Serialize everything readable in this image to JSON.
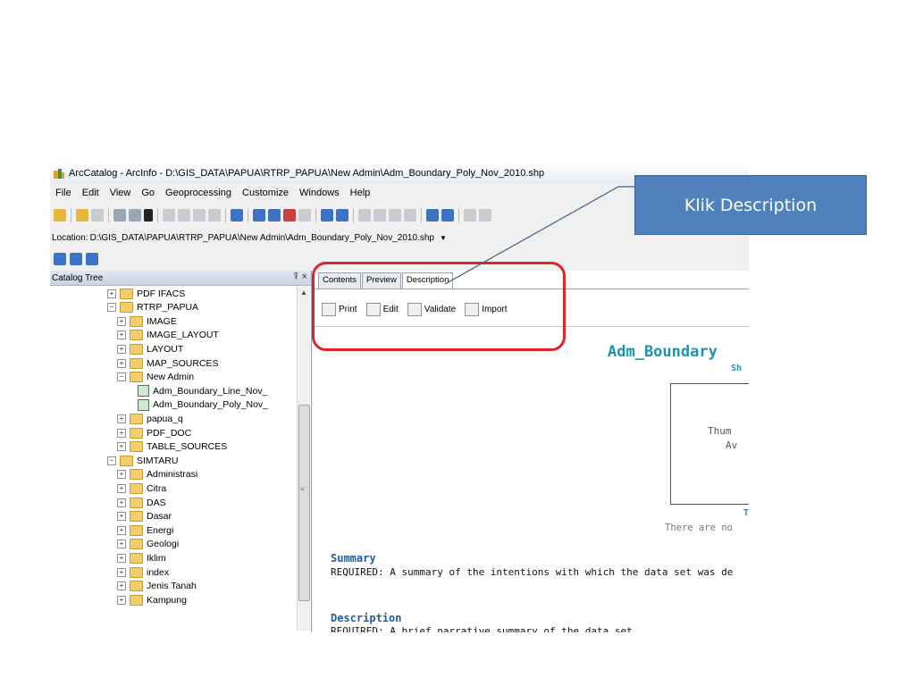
{
  "window": {
    "title": "ArcCatalog - ArcInfo - D:\\GIS_DATA\\PAPUA\\RTRP_PAPUA\\New Admin\\Adm_Boundary_Poly_Nov_2010.shp"
  },
  "menu": [
    "File",
    "Edit",
    "View",
    "Go",
    "Geoprocessing",
    "Customize",
    "Windows",
    "Help"
  ],
  "location": {
    "label": "Location:",
    "value": "D:\\GIS_DATA\\PAPUA\\RTRP_PAPUA\\New Admin\\Adm_Boundary_Poly_Nov_2010.shp"
  },
  "catalog_tree": {
    "title": "Catalog Tree",
    "pins": "⍒ ×",
    "items": [
      {
        "label": "PDF IFACS",
        "level": 0,
        "expander": "+",
        "kind": "folder"
      },
      {
        "label": "RTRP_PAPUA",
        "level": 0,
        "expander": "−",
        "kind": "folder"
      },
      {
        "label": "IMAGE",
        "level": 1,
        "expander": "+",
        "kind": "folder"
      },
      {
        "label": "IMAGE_LAYOUT",
        "level": 1,
        "expander": "+",
        "kind": "folder"
      },
      {
        "label": "LAYOUT",
        "level": 1,
        "expander": "+",
        "kind": "folder"
      },
      {
        "label": "MAP_SOURCES",
        "level": 1,
        "expander": "+",
        "kind": "folder"
      },
      {
        "label": "New Admin",
        "level": 1,
        "expander": "−",
        "kind": "folder"
      },
      {
        "label": "Adm_Boundary_Line_Nov_",
        "level": 2,
        "expander": "",
        "kind": "line"
      },
      {
        "label": "Adm_Boundary_Poly_Nov_",
        "level": 2,
        "expander": "",
        "kind": "poly"
      },
      {
        "label": "papua_q",
        "level": 1,
        "expander": "+",
        "kind": "folder"
      },
      {
        "label": "PDF_DOC",
        "level": 1,
        "expander": "+",
        "kind": "folder"
      },
      {
        "label": "TABLE_SOURCES",
        "level": 1,
        "expander": "+",
        "kind": "folder"
      },
      {
        "label": "SIMTARU",
        "level": 0,
        "expander": "−",
        "kind": "folder"
      },
      {
        "label": "Administrasi",
        "level": 1,
        "expander": "+",
        "kind": "folder"
      },
      {
        "label": "Citra",
        "level": 1,
        "expander": "+",
        "kind": "folder"
      },
      {
        "label": "DAS",
        "level": 1,
        "expander": "+",
        "kind": "folder"
      },
      {
        "label": "Dasar",
        "level": 1,
        "expander": "+",
        "kind": "folder"
      },
      {
        "label": "Energi",
        "level": 1,
        "expander": "+",
        "kind": "folder"
      },
      {
        "label": "Geologi",
        "level": 1,
        "expander": "+",
        "kind": "folder"
      },
      {
        "label": "Iklim",
        "level": 1,
        "expander": "+",
        "kind": "folder"
      },
      {
        "label": "index",
        "level": 1,
        "expander": "+",
        "kind": "folder"
      },
      {
        "label": "Jenis Tanah",
        "level": 1,
        "expander": "+",
        "kind": "folder"
      },
      {
        "label": "Kampung",
        "level": 1,
        "expander": "+",
        "kind": "folder"
      }
    ]
  },
  "tabs": [
    "Contents",
    "Preview",
    "Description"
  ],
  "desc_toolbar": [
    "Print",
    "Edit",
    "Validate",
    "Import"
  ],
  "document": {
    "title": "Adm_Boundary",
    "subtitle": "Sh",
    "thumb_text1": "Thum",
    "thumb_text2": "Av",
    "thumb_caption": "T",
    "thumb_caption2": "There are no",
    "summary_head": "Summary",
    "summary_text": "REQUIRED: A summary of the intentions with which the data set was de",
    "description_head": "Description",
    "description_text": "REQUIRED: A brief narrative summary of the data set."
  },
  "callout": {
    "text": "Klik Description",
    "color": "#4f81bd"
  },
  "highlight_color": "#e1232a"
}
